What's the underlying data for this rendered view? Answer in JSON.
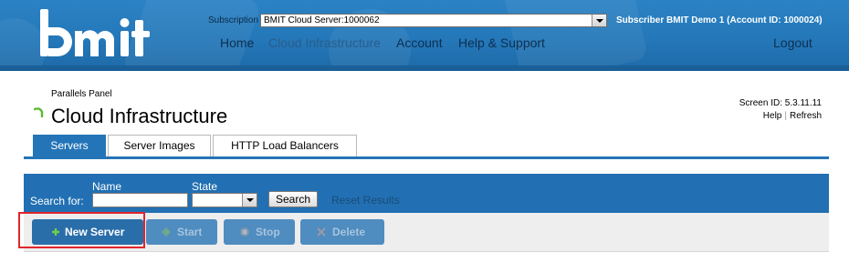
{
  "header": {
    "logo_text": "bmit",
    "subscription_label": "Subscription",
    "subscription_value": "BMIT Cloud Server:1000062",
    "subscriber_info": "Subscriber BMIT Demo 1 (Account ID: 1000024)",
    "nav": [
      {
        "label": "Home"
      },
      {
        "label": "Cloud Infrastructure"
      },
      {
        "label": "Account"
      },
      {
        "label": "Help & Support"
      },
      {
        "label": "Logout"
      }
    ]
  },
  "page": {
    "breadcrumb": "Parallels Panel",
    "title": "Cloud Infrastructure",
    "screen_id": "Screen ID:  5.3.11.11",
    "help_label": "Help",
    "refresh_label": "Refresh"
  },
  "tabs": [
    {
      "label": "Servers",
      "active": true
    },
    {
      "label": "Server Images",
      "active": false
    },
    {
      "label": "HTTP Load Balancers",
      "active": false
    }
  ],
  "search": {
    "search_for_label": "Search for:",
    "name_label": "Name",
    "name_value": "",
    "state_label": "State",
    "state_value": "",
    "search_button": "Search",
    "reset_label": "Reset Results"
  },
  "toolbar": {
    "new_server": "New Server",
    "start": "Start",
    "stop": "Stop",
    "delete": "Delete"
  },
  "colors": {
    "header_blue": "#2478b9",
    "panel_blue": "#2270b3",
    "button_blue": "#2d72ac",
    "highlight_red": "#e0262c"
  }
}
